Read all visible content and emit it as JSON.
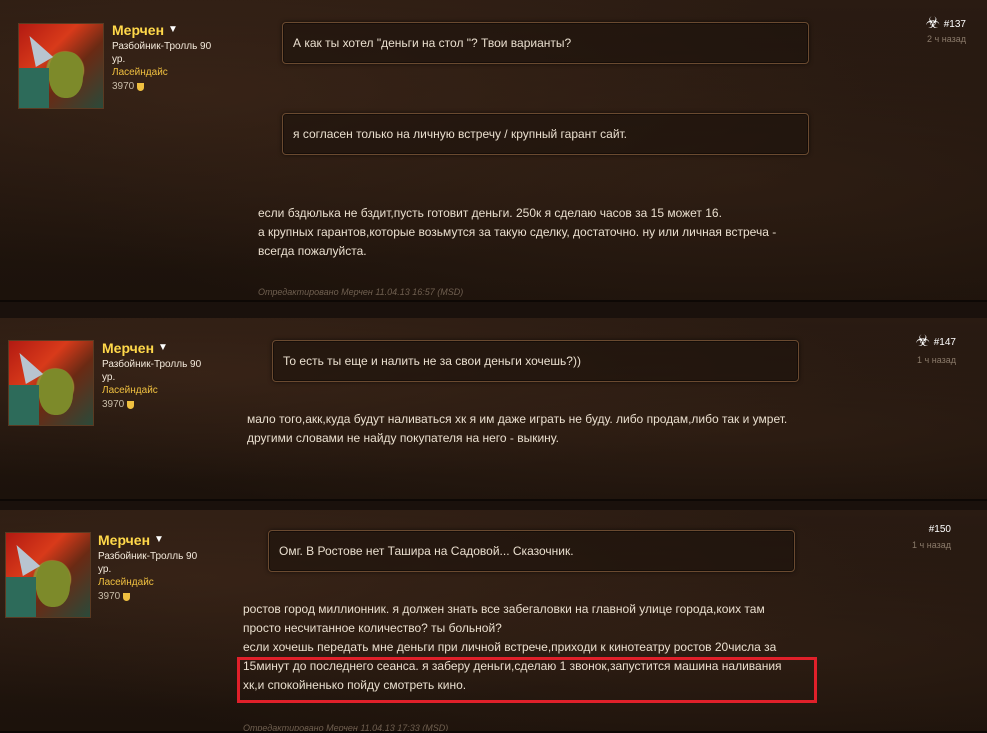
{
  "posts": [
    {
      "author": {
        "name": "Мерчен",
        "class_line": "Разбойник-Тролль 90 ур.",
        "realm": "Ласейндайс",
        "points": "3970"
      },
      "number": "#137",
      "time": "2 ч назад",
      "quotes": [
        "А как ты хотел \"деньги на стол \"? Твои варианты?",
        "я согласен только на личную встречу / крупный гарант сайт."
      ],
      "lines": [
        "если бздюлька не бздит,пусть готовит деньги. 250к я сделаю часов за 15 может 16.",
        "а крупных гарантов,которые возьмутся за такую сделку, достаточно. ну или личная встреча -",
        "всегда пожалуйста."
      ],
      "edited": "Отредактировано Мерчен 11.04.13 16:57 (MSD)"
    },
    {
      "author": {
        "name": "Мерчен",
        "class_line": "Разбойник-Тролль 90 ур.",
        "realm": "Ласейндайс",
        "points": "3970"
      },
      "number": "#147",
      "time": "1 ч назад",
      "quotes": [
        "То есть ты еще и налить не за свои деньги хочешь?))"
      ],
      "lines": [
        "мало того,акк,куда будут наливаться хк я им даже играть не буду. либо продам,либо так и умрет.",
        "другими словами не найду покупателя на него - выкину."
      ]
    },
    {
      "author": {
        "name": "Мерчен",
        "class_line": "Разбойник-Тролль 90 ур.",
        "realm": "Ласейндайс",
        "points": "3970"
      },
      "number": "#150",
      "time": "1 ч назад",
      "quotes": [
        "Омг. В Ростове нет Ташира на Садовой... Сказочник."
      ],
      "lines": [
        "ростов город миллионник. я должен знать все забегаловки на главной улице города,коих там",
        "просто несчитанное количество? ты больной?",
        "если хочешь передать мне деньги при личной встрече,приходи к кинотеатру ростов 20числа за",
        "15минут до последнего сеанса. я заберу деньги,сделаю 1 звонок,запустится машина наливания",
        "хк,и спокойненько пойду смотреть кино."
      ],
      "edited": "Отредактировано Мерчен 11.04.13 17:33 (MSD)"
    }
  ],
  "icons": {
    "biohazard": "biohazard-icon",
    "dropdown": "chevron-down-icon",
    "points": "shield-icon"
  },
  "colors": {
    "name": "#ffd84a",
    "realm": "#f0c040",
    "highlight": "#e0202a"
  }
}
